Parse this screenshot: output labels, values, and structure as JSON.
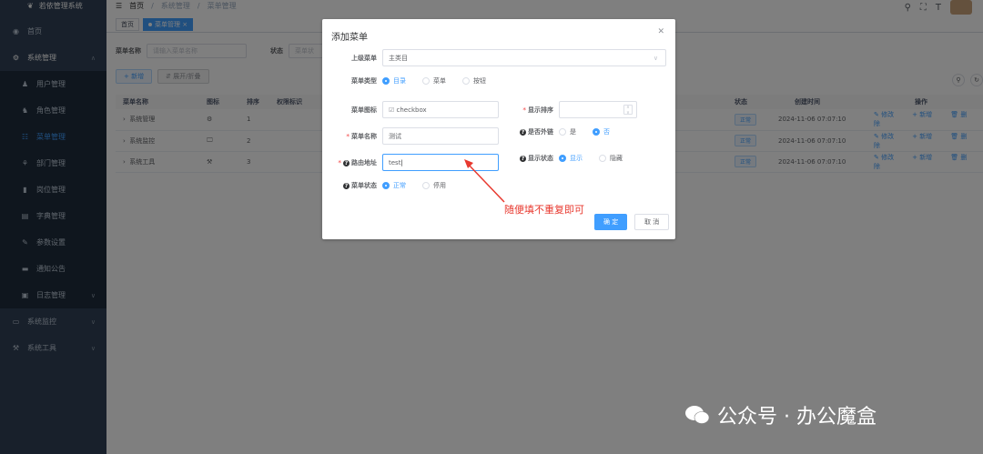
{
  "sidebar": {
    "logo_text": "若依管理系统",
    "items": [
      {
        "label": "首页",
        "icon": "dashboard-icon"
      },
      {
        "label": "系统管理",
        "icon": "gear-icon"
      },
      {
        "label": "用户管理",
        "icon": "user-icon"
      },
      {
        "label": "角色管理",
        "icon": "peoples-icon"
      },
      {
        "label": "菜单管理",
        "icon": "tree-table-icon"
      },
      {
        "label": "部门管理",
        "icon": "tree-icon"
      },
      {
        "label": "岗位管理",
        "icon": "post-icon"
      },
      {
        "label": "字典管理",
        "icon": "dict-icon"
      },
      {
        "label": "参数设置",
        "icon": "edit-icon"
      },
      {
        "label": "通知公告",
        "icon": "message-icon"
      },
      {
        "label": "日志管理",
        "icon": "log-icon"
      },
      {
        "label": "系统监控",
        "icon": "monitor-icon"
      },
      {
        "label": "系统工具",
        "icon": "tool-icon"
      }
    ]
  },
  "topbar": {
    "crumbs": [
      "首页",
      "系统管理",
      "菜单管理"
    ],
    "separator": "/"
  },
  "tags": {
    "home": "首页",
    "active": "菜单管理"
  },
  "search": {
    "name_label": "菜单名称",
    "name_placeholder": "请输入菜单名称",
    "status_label": "状态",
    "status_placeholder": "菜单状"
  },
  "toolbar": {
    "add": "+ 新增",
    "expand": "⇵ 展开/折叠"
  },
  "table": {
    "headers": [
      "菜单名称",
      "图标",
      "排序",
      "权限标识",
      "状态",
      "创建时间",
      "操作"
    ],
    "rows": [
      {
        "name": "系统管理",
        "icon": "⚙",
        "order": "1",
        "status": "正常",
        "time": "2024-11-06 07:07:10"
      },
      {
        "name": "系统监控",
        "icon": "🖵",
        "order": "2",
        "status": "正常",
        "time": "2024-11-06 07:07:10"
      },
      {
        "name": "系统工具",
        "icon": "⚒",
        "order": "3",
        "status": "正常",
        "time": "2024-11-06 07:07:10"
      }
    ],
    "ops": [
      "修改",
      "新增",
      "删除"
    ]
  },
  "dialog": {
    "title": "添加菜单",
    "parent_label": "上级菜单",
    "parent_value": "主类目",
    "type_label": "菜单类型",
    "type_options": [
      "目录",
      "菜单",
      "按钮"
    ],
    "icon_label": "菜单图标",
    "icon_value": "checkbox",
    "order_label": "显示排序",
    "name_label": "菜单名称",
    "name_value": "测试",
    "external_label": "是否外链",
    "external_options": [
      "是",
      "否"
    ],
    "route_label": "路由地址",
    "route_value": "test",
    "visible_label": "显示状态",
    "visible_options": [
      "显示",
      "隐藏"
    ],
    "status_label": "菜单状态",
    "status_options": [
      "正常",
      "停用"
    ],
    "ok": "确 定",
    "cancel": "取 消"
  },
  "annotation": {
    "text": "随便填不重复即可",
    "color": "#e8392f"
  },
  "watermark": {
    "text": "公众号 · 办公魔盒"
  }
}
